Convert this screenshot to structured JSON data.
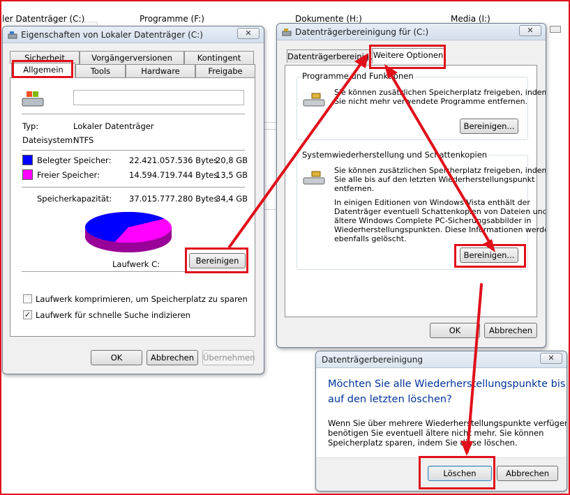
{
  "explorer": {
    "drives": [
      "ler Datenträger (C:)",
      "Programme (F:)",
      "Dokumente (H:)",
      "Media (I:)"
    ]
  },
  "props": {
    "title": "Eigenschaften von Lokaler Datenträger (C:)",
    "close": "✕",
    "tabs_row1": [
      "Sicherheit",
      "Vorgängerversionen",
      "Kontingent"
    ],
    "tabs_row2": [
      "Allgemein",
      "Tools",
      "Hardware",
      "Freigabe"
    ],
    "name_value": "",
    "type_label": "Typ:",
    "type_value": "Lokaler Datenträger",
    "fs_label": "Dateisystem:",
    "fs_value": "NTFS",
    "used_label": "Belegter Speicher:",
    "used_bytes": "22.421.057.536 Bytes",
    "used_gb": "20,8 GB",
    "free_label": "Freier Speicher:",
    "free_bytes": "14.594.719.744 Bytes",
    "free_gb": "13,5 GB",
    "cap_label": "Speicherkapazität:",
    "cap_bytes": "37.015.777.280 Bytes",
    "cap_gb": "34,4 GB",
    "drive_label": "Laufwerk C:",
    "cleanup_button": "Bereinigen",
    "compress_label": "Laufwerk komprimieren, um Speicherplatz zu sparen",
    "compress_checked": false,
    "index_label": "Laufwerk für schnelle Suche indizieren",
    "index_checked": true,
    "check_mark": "✓",
    "ok": "OK",
    "cancel": "Abbrechen",
    "apply": "Übernehmen",
    "used_fraction": 0.606,
    "colors": {
      "used": "#0000ff",
      "free": "#ff00ff"
    }
  },
  "cleanup": {
    "title": "Datenträgerbereinigung für  (C:)",
    "close": "✕",
    "tab1": "Datenträgerbereinigung",
    "tab2": "Weitere Optionen",
    "group1_title": "Programme und Funktionen",
    "group1_text": [
      "Sie können zusätzlichen Speicherplatz freigeben, indem",
      "Sie nicht mehr verwendete Programme entfernen."
    ],
    "group1_button": "Bereinigen...",
    "group2_title": "Systemwiederherstellung und Schattenkopien",
    "group2_text": [
      "Sie können zusätzlichen Speicherplatz freigeben, indem",
      "Sie alle bis auf den letzten Wiederherstellungspunkt",
      "entfernen."
    ],
    "group2_text2": [
      "In einigen Editionen von Windows Vista enthält der",
      "Datenträger eventuell Schattenkopien von Dateien und",
      "ältere Windows Complete PC-Sicherungsabbilder in",
      "Wiederherstellungspunkten. Diese Informationen werden",
      "ebenfalls gelöscht."
    ],
    "group2_button": "Bereinigen...",
    "ok": "OK",
    "cancel": "Abbrechen"
  },
  "confirm": {
    "title": "Datenträgerbereinigung",
    "close": "✕",
    "question": [
      "Möchten Sie alle Wiederherstellungspunkte bis",
      "auf den letzten löschen?"
    ],
    "body": [
      "Wenn Sie über mehrere Wiederherstellungspunkte verfügen,",
      "benötigen Sie eventuell ältere nicht mehr. Sie können",
      "Speicherplatz sparen, indem Sie diese löschen."
    ],
    "delete": "Löschen",
    "cancel": "Abbrechen"
  },
  "colors": {
    "annotation": "#e0101a",
    "question_text": "#003399"
  }
}
